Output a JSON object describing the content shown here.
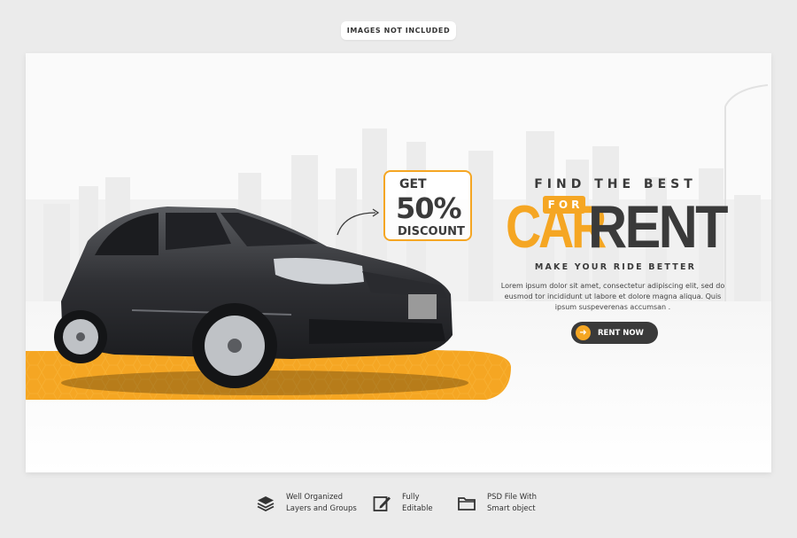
{
  "top_label": "IMAGES NOT INCLUDED",
  "banner": {
    "discount": {
      "line1": "GET",
      "line2": "50%",
      "line3": "DISCOUNT"
    },
    "headline_top": "FIND THE BEST",
    "for_badge": "FOR",
    "car_word": "CAR",
    "rent_word": "RENT",
    "tagline": "MAKE YOUR RIDE BETTER",
    "body": "Lorem ipsum dolor sit amet, consectetur adipiscing elit, sed do eusmod tor incididunt ut labore et dolore magna aliqua. Quis ipsum suspeverenas accumsan .",
    "button_label": "RENT NOW",
    "accent_color": "#f5a623",
    "dark_color": "#3a3a3a"
  },
  "features": [
    {
      "icon": "layers-icon",
      "line1": "Well Organized",
      "line2": "Layers and Groups"
    },
    {
      "icon": "edit-icon",
      "line1": "Fully",
      "line2": "Editable"
    },
    {
      "icon": "folder-icon",
      "line1": "PSD File With",
      "line2": "Smart object"
    }
  ]
}
